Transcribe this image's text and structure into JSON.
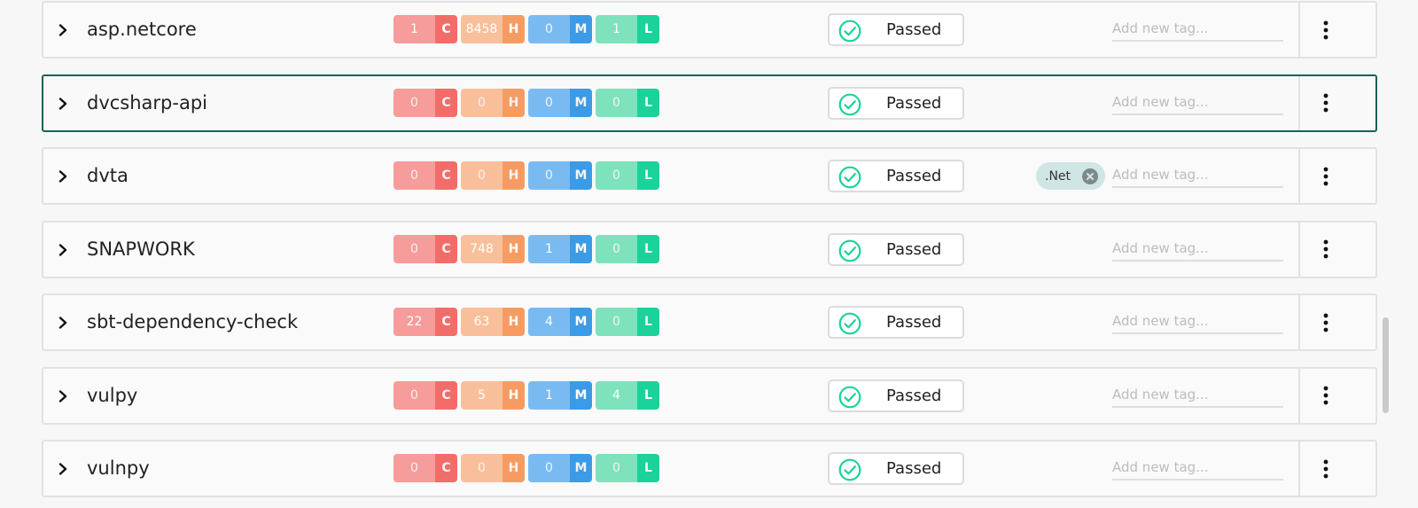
{
  "status_label": "Passed",
  "tag_placeholder": "Add new tag...",
  "severity_letters": {
    "critical": "C",
    "high": "H",
    "medium": "M",
    "low": "L"
  },
  "colors": {
    "critical": "#f26d69",
    "high": "#f69c63",
    "medium": "#3b9be6",
    "low": "#1bd29a",
    "zero": "#cfcfcf",
    "passed_check": "#1bd29a",
    "selected_border": "#1d5f5b"
  },
  "projects": [
    {
      "name": "asp.netcore",
      "counts": {
        "critical": "1",
        "high": "8458",
        "medium": "0",
        "low": "1"
      },
      "status": "Passed",
      "tags": [],
      "selected": false
    },
    {
      "name": "dvcsharp-api",
      "counts": {
        "critical": "0",
        "high": "0",
        "medium": "0",
        "low": "0"
      },
      "status": "Passed",
      "tags": [],
      "selected": true
    },
    {
      "name": "dvta",
      "counts": {
        "critical": "0",
        "high": "0",
        "medium": "0",
        "low": "0"
      },
      "status": "Passed",
      "tags": [
        ".Net"
      ],
      "selected": false
    },
    {
      "name": "SNAPWORK",
      "counts": {
        "critical": "0",
        "high": "748",
        "medium": "1",
        "low": "0"
      },
      "status": "Passed",
      "tags": [],
      "selected": false
    },
    {
      "name": "sbt-dependency-check",
      "counts": {
        "critical": "22",
        "high": "63",
        "medium": "4",
        "low": "0"
      },
      "status": "Passed",
      "tags": [],
      "selected": false
    },
    {
      "name": "vulpy",
      "counts": {
        "critical": "0",
        "high": "5",
        "medium": "1",
        "low": "4"
      },
      "status": "Passed",
      "tags": [],
      "selected": false
    },
    {
      "name": "vulnpy",
      "counts": {
        "critical": "0",
        "high": "0",
        "medium": "0",
        "low": "0"
      },
      "status": "Passed",
      "tags": [],
      "selected": false
    }
  ],
  "icons": {
    "expand": "chevron-right-icon",
    "status": "check-circle-icon",
    "tag_remove": "close-circle-icon",
    "menu": "more-vertical-icon"
  }
}
